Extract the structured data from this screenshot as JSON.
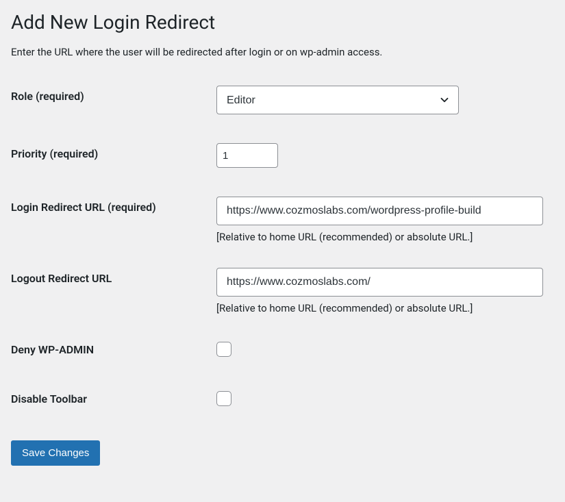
{
  "heading": "Add New Login Redirect",
  "description": "Enter the URL where the user will be redirected after login or on wp-admin access.",
  "fields": {
    "role": {
      "label": "Role",
      "required_label": "(required)",
      "value": "Editor"
    },
    "priority": {
      "label": "Priority",
      "required_label": "(required)",
      "value": "1"
    },
    "login_redirect": {
      "label": "Login Redirect URL",
      "required_label": "(required)",
      "value": "https://www.cozmoslabs.com/wordpress-profile-build",
      "help": "[Relative to home URL (recommended) or absolute URL.]"
    },
    "logout_redirect": {
      "label": "Logout Redirect URL",
      "value": "https://www.cozmoslabs.com/",
      "help": "[Relative to home URL (recommended) or absolute URL.]"
    },
    "deny_wp_admin": {
      "label": "Deny WP-ADMIN"
    },
    "disable_toolbar": {
      "label": "Disable Toolbar"
    }
  },
  "submit_label": "Save Changes"
}
